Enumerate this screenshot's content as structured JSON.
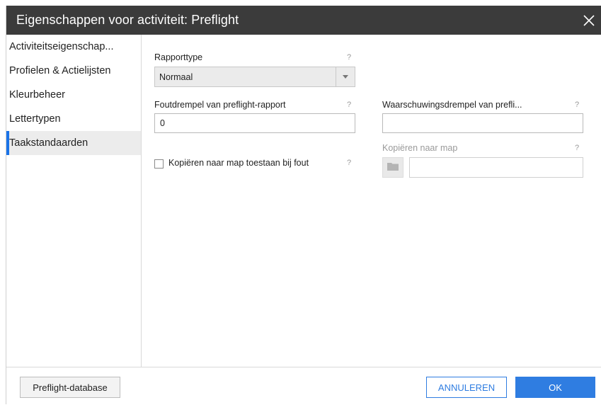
{
  "dialog": {
    "title": "Eigenschappen voor activiteit: Preflight"
  },
  "sidebar": {
    "items": [
      {
        "label": "Activiteitseigenschap..."
      },
      {
        "label": "Profielen & Actielijsten"
      },
      {
        "label": "Kleurbeheer"
      },
      {
        "label": "Lettertypen"
      },
      {
        "label": "Taakstandaarden",
        "active": true
      }
    ]
  },
  "form": {
    "report_type": {
      "label": "Rapporttype",
      "value": "Normaal",
      "help": "?"
    },
    "error_threshold": {
      "label": "Foutdrempel van preflight-rapport",
      "value": "0",
      "help": "?"
    },
    "warning_threshold": {
      "label": "Waarschuwingsdrempel van prefli...",
      "value": "",
      "help": "?"
    },
    "copy_on_error": {
      "label": "Kopiëren naar map toestaan bij fout",
      "checked": false,
      "help": "?"
    },
    "copy_folder": {
      "label": "Kopiëren naar map",
      "value": "",
      "help": "?",
      "disabled": true
    }
  },
  "footer": {
    "database_button": "Preflight-database",
    "cancel_button": "ANNULEREN",
    "ok_button": "OK"
  },
  "colors": {
    "titlebar": "#3b3b3b",
    "accent": "#2f7de1",
    "active_nav_bg": "#ececec"
  }
}
